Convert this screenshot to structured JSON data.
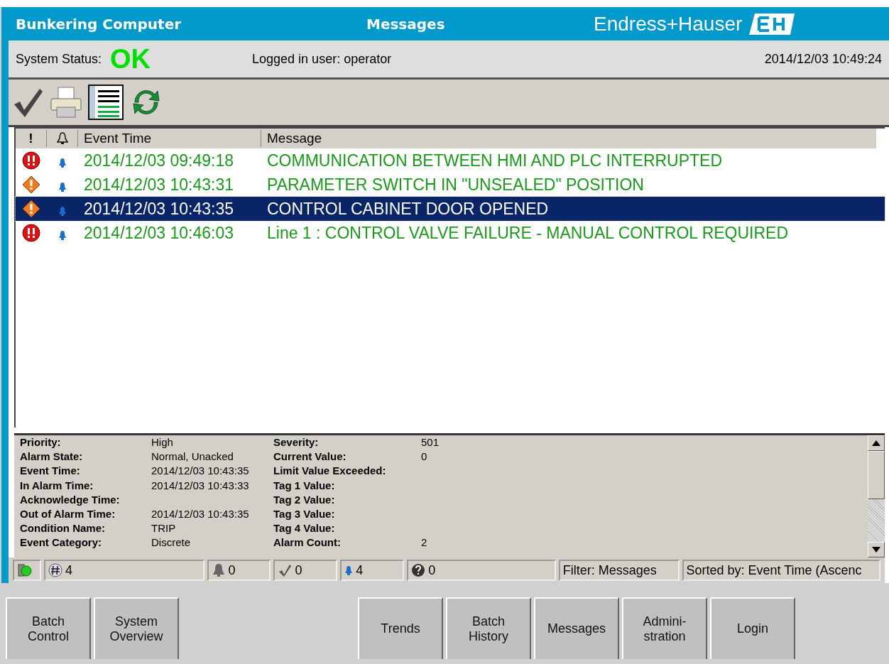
{
  "header": {
    "app_title": "Bunkering Computer",
    "page_title": "Messages",
    "brand": "Endress+Hauser"
  },
  "status_bar": {
    "label": "System Status:",
    "status": "OK",
    "user": "Logged in user: operator",
    "datetime": "2014/12/03 10:49:24"
  },
  "toolbar": [
    {
      "kind": "check"
    },
    {
      "kind": "print"
    },
    {
      "kind": "list"
    },
    {
      "kind": "refresh"
    }
  ],
  "table": {
    "columns": [
      "!",
      "Event Time",
      "Message"
    ],
    "rows": [
      {
        "kind": "high",
        "time": "2014/12/03 09:49:18",
        "message": "COMMUNICATION BETWEEN HMI AND PLC INTERRUPTED",
        "selected": false
      },
      {
        "kind": "medium",
        "time": "2014/12/03 10:43:31",
        "message": "PARAMETER SWITCH IN \"UNSEALED\" POSITION",
        "selected": false
      },
      {
        "kind": "medium",
        "time": "2014/12/03 10:43:35",
        "message": "CONTROL CABINET DOOR OPENED",
        "selected": true
      },
      {
        "kind": "high",
        "time": "2014/12/03 10:46:03",
        "message": "Line 1 : CONTROL VALVE FAILURE - MANUAL CONTROL REQUIRED",
        "selected": false
      }
    ]
  },
  "details": [
    {
      "label": "Priority:",
      "value": "High",
      "label2": "Severity:",
      "value2": "501"
    },
    {
      "label": "Alarm State:",
      "value": "Normal, Unacked",
      "label2": "Current Value:",
      "value2": "0"
    },
    {
      "label": "Event Time:",
      "value": "2014/12/03 10:43:35",
      "label2": "Limit Value Exceeded:"
    },
    {
      "label": "In Alarm Time:",
      "value": "2014/12/03 10:43:33",
      "label2": "Tag 1 Value:"
    },
    {
      "label": "Acknowledge Time:",
      "label2": "Tag 2 Value:"
    },
    {
      "label": "Out of Alarm Time:",
      "value": "2014/12/03 10:43:35",
      "label2": "Tag 3 Value:"
    },
    {
      "label": "Condition Name:",
      "value": "TRIP",
      "label2": "Tag 4 Value:"
    },
    {
      "label": "Event Category:",
      "value": "Discrete",
      "label2": "Alarm Count:",
      "value2": "2"
    }
  ],
  "counters": [
    {
      "kind": "connection"
    },
    {
      "kind": "total",
      "text": "4"
    },
    {
      "kind": "active",
      "text": "0"
    },
    {
      "kind": "acked",
      "text": "0"
    },
    {
      "kind": "unacked",
      "text": "4"
    },
    {
      "kind": "unknown",
      "text": "0"
    }
  ],
  "filter": "Filter: Messages",
  "sort": "Sorted by: Event Time (Ascenc",
  "nav_buttons": [
    {
      "label": "Batch\nControl"
    },
    {
      "label": "System\nOverview"
    },
    {
      "kind": "spacer"
    },
    {
      "label": "Trends"
    },
    {
      "label": "Batch\nHistory"
    },
    {
      "label": "Messages"
    },
    {
      "label": "Admini-\nstration"
    },
    {
      "label": "Login"
    }
  ]
}
